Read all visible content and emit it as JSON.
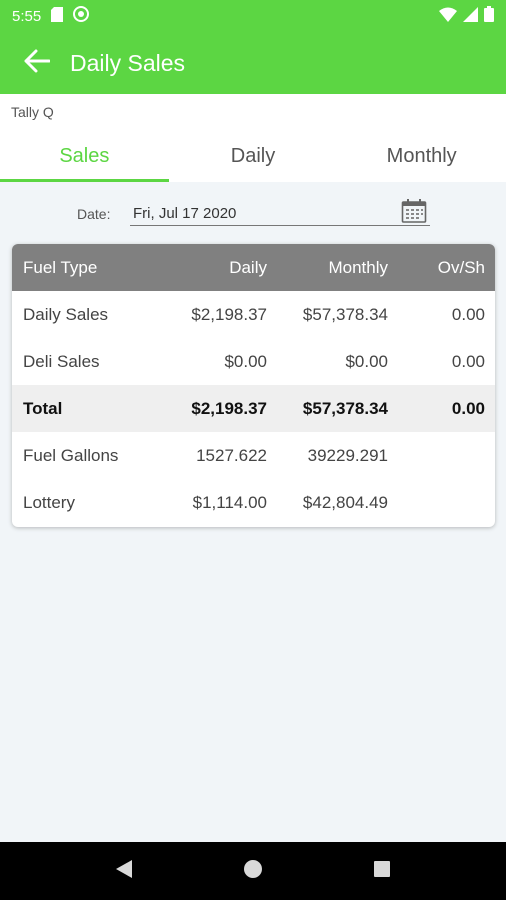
{
  "status": {
    "time": "5:55"
  },
  "toolbar": {
    "title": "Daily Sales"
  },
  "subheader": {
    "text": "Tally Q"
  },
  "tabs": [
    {
      "label": "Sales",
      "active": true
    },
    {
      "label": "Daily",
      "active": false
    },
    {
      "label": "Monthly",
      "active": false
    }
  ],
  "date": {
    "label": "Date:",
    "value": "Fri, Jul 17 2020"
  },
  "table": {
    "headers": [
      "Fuel Type",
      "Daily",
      "Monthly",
      "Ov/Sh"
    ],
    "rows": [
      [
        "Daily Sales",
        "$2,198.37",
        "$57,378.34",
        "0.00"
      ],
      [
        "Deli Sales",
        "$0.00",
        "$0.00",
        "0.00"
      ],
      [
        "Total",
        "$2,198.37",
        "$57,378.34",
        "0.00"
      ],
      [
        "Fuel Gallons",
        "1527.622",
        "39229.291",
        ""
      ],
      [
        "Lottery",
        "$1,114.00",
        "$42,804.49",
        ""
      ]
    ]
  },
  "colors": {
    "accent": "#5cd643",
    "header_gray": "#808080"
  },
  "icons": {
    "back": "arrow-back-icon",
    "calendar": "calendar-icon",
    "nav_back": "triangle-back-icon",
    "nav_home": "circle-home-icon",
    "nav_recents": "square-recents-icon"
  }
}
